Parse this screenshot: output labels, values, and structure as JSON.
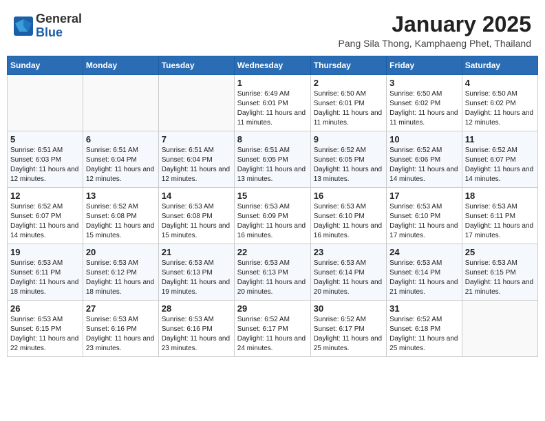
{
  "logo": {
    "general": "General",
    "blue": "Blue"
  },
  "title": "January 2025",
  "subtitle": "Pang Sila Thong, Kamphaeng Phet, Thailand",
  "days_of_week": [
    "Sunday",
    "Monday",
    "Tuesday",
    "Wednesday",
    "Thursday",
    "Friday",
    "Saturday"
  ],
  "weeks": [
    [
      {
        "day": "",
        "info": ""
      },
      {
        "day": "",
        "info": ""
      },
      {
        "day": "",
        "info": ""
      },
      {
        "day": "1",
        "info": "Sunrise: 6:49 AM\nSunset: 6:01 PM\nDaylight: 11 hours and 11 minutes."
      },
      {
        "day": "2",
        "info": "Sunrise: 6:50 AM\nSunset: 6:01 PM\nDaylight: 11 hours and 11 minutes."
      },
      {
        "day": "3",
        "info": "Sunrise: 6:50 AM\nSunset: 6:02 PM\nDaylight: 11 hours and 11 minutes."
      },
      {
        "day": "4",
        "info": "Sunrise: 6:50 AM\nSunset: 6:02 PM\nDaylight: 11 hours and 12 minutes."
      }
    ],
    [
      {
        "day": "5",
        "info": "Sunrise: 6:51 AM\nSunset: 6:03 PM\nDaylight: 11 hours and 12 minutes."
      },
      {
        "day": "6",
        "info": "Sunrise: 6:51 AM\nSunset: 6:04 PM\nDaylight: 11 hours and 12 minutes."
      },
      {
        "day": "7",
        "info": "Sunrise: 6:51 AM\nSunset: 6:04 PM\nDaylight: 11 hours and 12 minutes."
      },
      {
        "day": "8",
        "info": "Sunrise: 6:51 AM\nSunset: 6:05 PM\nDaylight: 11 hours and 13 minutes."
      },
      {
        "day": "9",
        "info": "Sunrise: 6:52 AM\nSunset: 6:05 PM\nDaylight: 11 hours and 13 minutes."
      },
      {
        "day": "10",
        "info": "Sunrise: 6:52 AM\nSunset: 6:06 PM\nDaylight: 11 hours and 14 minutes."
      },
      {
        "day": "11",
        "info": "Sunrise: 6:52 AM\nSunset: 6:07 PM\nDaylight: 11 hours and 14 minutes."
      }
    ],
    [
      {
        "day": "12",
        "info": "Sunrise: 6:52 AM\nSunset: 6:07 PM\nDaylight: 11 hours and 14 minutes."
      },
      {
        "day": "13",
        "info": "Sunrise: 6:52 AM\nSunset: 6:08 PM\nDaylight: 11 hours and 15 minutes."
      },
      {
        "day": "14",
        "info": "Sunrise: 6:53 AM\nSunset: 6:08 PM\nDaylight: 11 hours and 15 minutes."
      },
      {
        "day": "15",
        "info": "Sunrise: 6:53 AM\nSunset: 6:09 PM\nDaylight: 11 hours and 16 minutes."
      },
      {
        "day": "16",
        "info": "Sunrise: 6:53 AM\nSunset: 6:10 PM\nDaylight: 11 hours and 16 minutes."
      },
      {
        "day": "17",
        "info": "Sunrise: 6:53 AM\nSunset: 6:10 PM\nDaylight: 11 hours and 17 minutes."
      },
      {
        "day": "18",
        "info": "Sunrise: 6:53 AM\nSunset: 6:11 PM\nDaylight: 11 hours and 17 minutes."
      }
    ],
    [
      {
        "day": "19",
        "info": "Sunrise: 6:53 AM\nSunset: 6:11 PM\nDaylight: 11 hours and 18 minutes."
      },
      {
        "day": "20",
        "info": "Sunrise: 6:53 AM\nSunset: 6:12 PM\nDaylight: 11 hours and 18 minutes."
      },
      {
        "day": "21",
        "info": "Sunrise: 6:53 AM\nSunset: 6:13 PM\nDaylight: 11 hours and 19 minutes."
      },
      {
        "day": "22",
        "info": "Sunrise: 6:53 AM\nSunset: 6:13 PM\nDaylight: 11 hours and 20 minutes."
      },
      {
        "day": "23",
        "info": "Sunrise: 6:53 AM\nSunset: 6:14 PM\nDaylight: 11 hours and 20 minutes."
      },
      {
        "day": "24",
        "info": "Sunrise: 6:53 AM\nSunset: 6:14 PM\nDaylight: 11 hours and 21 minutes."
      },
      {
        "day": "25",
        "info": "Sunrise: 6:53 AM\nSunset: 6:15 PM\nDaylight: 11 hours and 21 minutes."
      }
    ],
    [
      {
        "day": "26",
        "info": "Sunrise: 6:53 AM\nSunset: 6:15 PM\nDaylight: 11 hours and 22 minutes."
      },
      {
        "day": "27",
        "info": "Sunrise: 6:53 AM\nSunset: 6:16 PM\nDaylight: 11 hours and 23 minutes."
      },
      {
        "day": "28",
        "info": "Sunrise: 6:53 AM\nSunset: 6:16 PM\nDaylight: 11 hours and 23 minutes."
      },
      {
        "day": "29",
        "info": "Sunrise: 6:52 AM\nSunset: 6:17 PM\nDaylight: 11 hours and 24 minutes."
      },
      {
        "day": "30",
        "info": "Sunrise: 6:52 AM\nSunset: 6:17 PM\nDaylight: 11 hours and 25 minutes."
      },
      {
        "day": "31",
        "info": "Sunrise: 6:52 AM\nSunset: 6:18 PM\nDaylight: 11 hours and 25 minutes."
      },
      {
        "day": "",
        "info": ""
      }
    ]
  ]
}
